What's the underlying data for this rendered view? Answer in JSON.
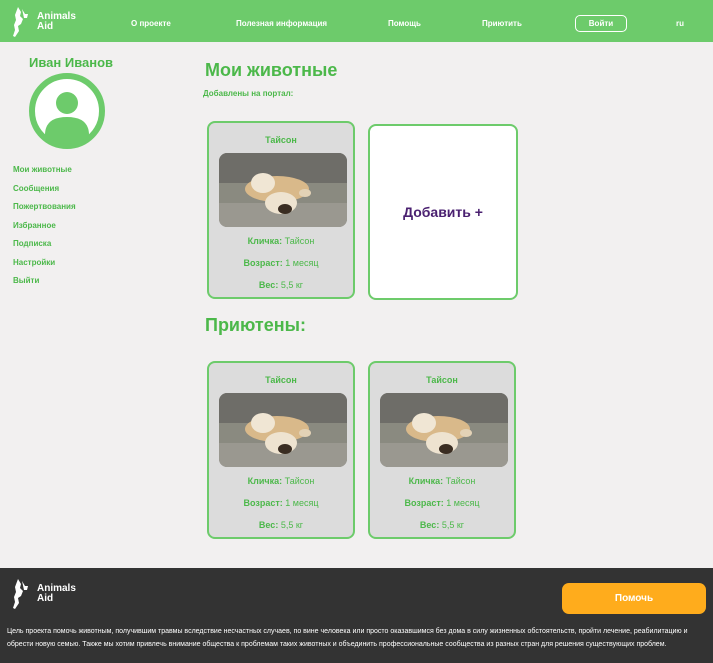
{
  "header": {
    "logo_text_line1": "Animals",
    "logo_text_line2": "Aid",
    "nav": [
      "О проекте",
      "Полезная информация",
      "Помощь",
      "Приютить"
    ],
    "login_label": "Войти",
    "lang": "ru"
  },
  "profile": {
    "name": "Иван Иванов",
    "menu": [
      "Мои животные",
      "Сообщения",
      "Пожертвования",
      "Избранное",
      "Подписка",
      "Настройки",
      "Выйти"
    ]
  },
  "my_animals": {
    "title": "Мои животные",
    "subtitle": "Добавлены на портал:",
    "cards": [
      {
        "name": "Тайсон",
        "nick_label": "Кличка:",
        "nick": "Тайсон",
        "age_label": "Возраст:",
        "age": "1 месяц",
        "weight_label": "Вес:",
        "weight": "5,5 кг"
      }
    ],
    "add_label": "Добавить +"
  },
  "sheltered": {
    "title": "Приютены:",
    "cards": [
      {
        "name": "Тайсон",
        "nick_label": "Кличка:",
        "nick": "Тайсон",
        "age_label": "Возраст:",
        "age": "1 месяц",
        "weight_label": "Вес:",
        "weight": "5,5 кг"
      },
      {
        "name": "Тайсон",
        "nick_label": "Кличка:",
        "nick": "Тайсон",
        "age_label": "Возраст:",
        "age": "1 месяц",
        "weight_label": "Вес:",
        "weight": "5,5 кг"
      }
    ]
  },
  "footer": {
    "logo_text_line1": "Animals",
    "logo_text_line2": "Aid",
    "help_label": "Помочь",
    "description": "Цель проекта помочь животным, получившим травмы вследствие несчастных случаев, по вине человека или просто оказавшимся без дома в силу жизненных обстоятельств, пройти лечение, реабилитацию и обрести новую семью. Также мы хотим привлечь внимание общества к проблемам таких животных и объединить профессиональные сообщества из разных стран для решения существующих проблем."
  },
  "colors": {
    "green": "#6dcb6b",
    "text_green": "#4cb84a",
    "orange": "#ffac1c",
    "footer_bg": "#333333",
    "add_text": "#4a2070"
  }
}
